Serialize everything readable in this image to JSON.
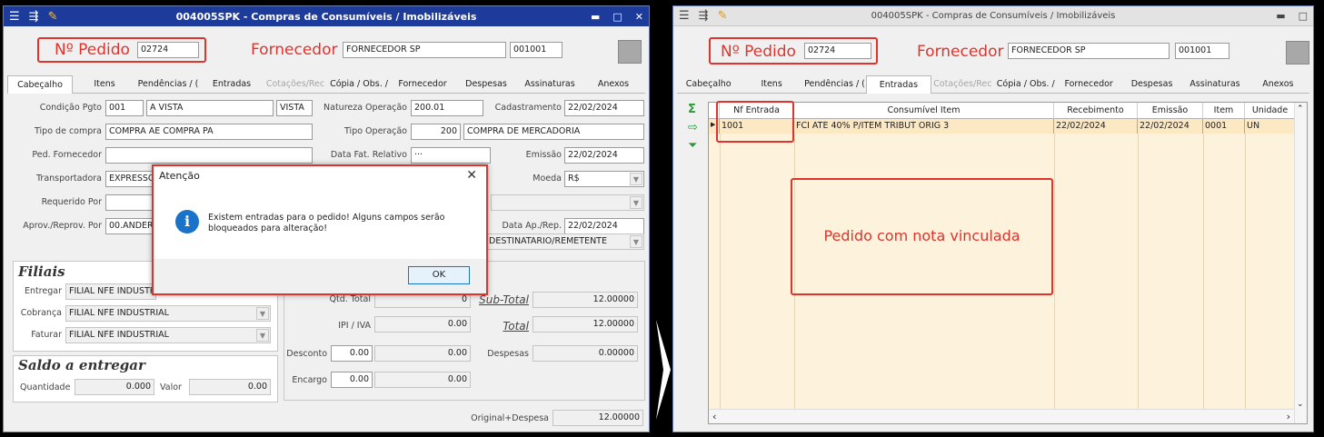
{
  "left_window": {
    "title": "004005SPK - Compras de Consumíveis / Imobilizáveis",
    "pedido_label": "Nº Pedido",
    "pedido_value": "02724",
    "fornecedor_label": "Fornecedor",
    "fornecedor_value": "FORNECEDOR SP",
    "fornecedor_code": "001001",
    "tabs": [
      "Cabeçalho",
      "Itens",
      "Pendências / (",
      "Entradas",
      "Cotações/Rec",
      "Cópia / Obs. /",
      "Fornecedor",
      "Despesas",
      "Assinaturas",
      "Anexos"
    ],
    "form": {
      "condicao_label": "Condição Pgto",
      "condicao_code": "001",
      "condicao_value": "A VISTA",
      "condicao_tipo": "VISTA",
      "natureza_label": "Natureza Operação",
      "natureza_value": "200.01",
      "cadastramento_label": "Cadastramento",
      "cadastramento_value": "22/02/2024",
      "tipo_compra_label": "Tipo de compra",
      "tipo_compra_value": "COMPRA AE COMPRA PA",
      "tipo_operacao_label": "Tipo Operação",
      "tipo_operacao_code": "200",
      "tipo_operacao_value": "COMPRA DE MERCADORIA",
      "ped_fornecedor_label": "Ped. Fornecedor",
      "data_fat_label": "Data Fat. Relativo",
      "data_fat_value": "···",
      "emissao_label": "Emissão",
      "emissao_value": "22/02/2024",
      "transportadora_label": "Transportadora",
      "transportadora_value": "EXPRESSO",
      "moeda_label": "Moeda",
      "moeda_value": "R$",
      "requerido_label": "Requerido Por",
      "aprov_label": "Aprov./Reprov. Por",
      "aprov_value": "00.ANDERS",
      "data_ap_label": "Data Ap./Rep.",
      "data_ap_value": "22/02/2024",
      "destinatario_value": "DESTINATARIO/REMETENTE"
    },
    "filiais": {
      "title": "Filiais",
      "entregar_label": "Entregar",
      "entregar_value": "FILIAL NFE INDUSTRI",
      "cobranca_label": "Cobrança",
      "cobranca_value": "FILIAL NFE INDUSTRIAL",
      "faturar_label": "Faturar",
      "faturar_value": "FILIAL NFE INDUSTRIAL"
    },
    "saldo": {
      "title": "Saldo a entregar",
      "quantidade_label": "Quantidade",
      "quantidade_value": "0.000",
      "valor_label": "Valor",
      "valor_value": "0.00"
    },
    "totais": {
      "qtd_total_label": "Qtd. Total",
      "qtd_total_value": "0",
      "subtotal_label": "Sub-Total",
      "subtotal_value": "12.00000",
      "ipi_label": "IPI / IVA",
      "ipi_value": "0.00",
      "total_label": "Total",
      "total_value": "12.00000",
      "desconto_label": "Desconto",
      "desconto_value1": "0.00",
      "desconto_value2": "0.00",
      "despesas_label": "Despesas",
      "despesas_value": "0.00000",
      "encargo_label": "Encargo",
      "encargo_value1": "0.00",
      "encargo_value2": "0.00",
      "original_label": "Original+Despesa",
      "original_value": "12.00000"
    },
    "dialog": {
      "title": "Atenção",
      "message": "Existem entradas para o pedido! Alguns campos serão bloqueados para alteração!",
      "ok": "OK"
    }
  },
  "right_window": {
    "title": "004005SPK - Compras de Consumíveis / Imobilizáveis",
    "pedido_label": "Nº Pedido",
    "pedido_value": "02724",
    "fornecedor_label": "Fornecedor",
    "fornecedor_value": "FORNECEDOR SP",
    "fornecedor_code": "001001",
    "tabs": [
      "Cabeçalho",
      "Itens",
      "Pendências / (",
      "Entradas",
      "Cotações/Rec",
      "Cópia / Obs. /",
      "Fornecedor",
      "Despesas",
      "Assinaturas",
      "Anexos"
    ],
    "grid": {
      "columns": [
        "Nf Entrada",
        "Consumível Item",
        "Recebimento",
        "Emissão",
        "Item",
        "Unidade"
      ],
      "rows": [
        [
          "1001",
          "FCI ATE 40% P/ITEM TRIBUT ORIG 3",
          "22/02/2024",
          "22/02/2024",
          "0001",
          "UN"
        ]
      ]
    },
    "note": "Pedido com nota vinculada"
  }
}
